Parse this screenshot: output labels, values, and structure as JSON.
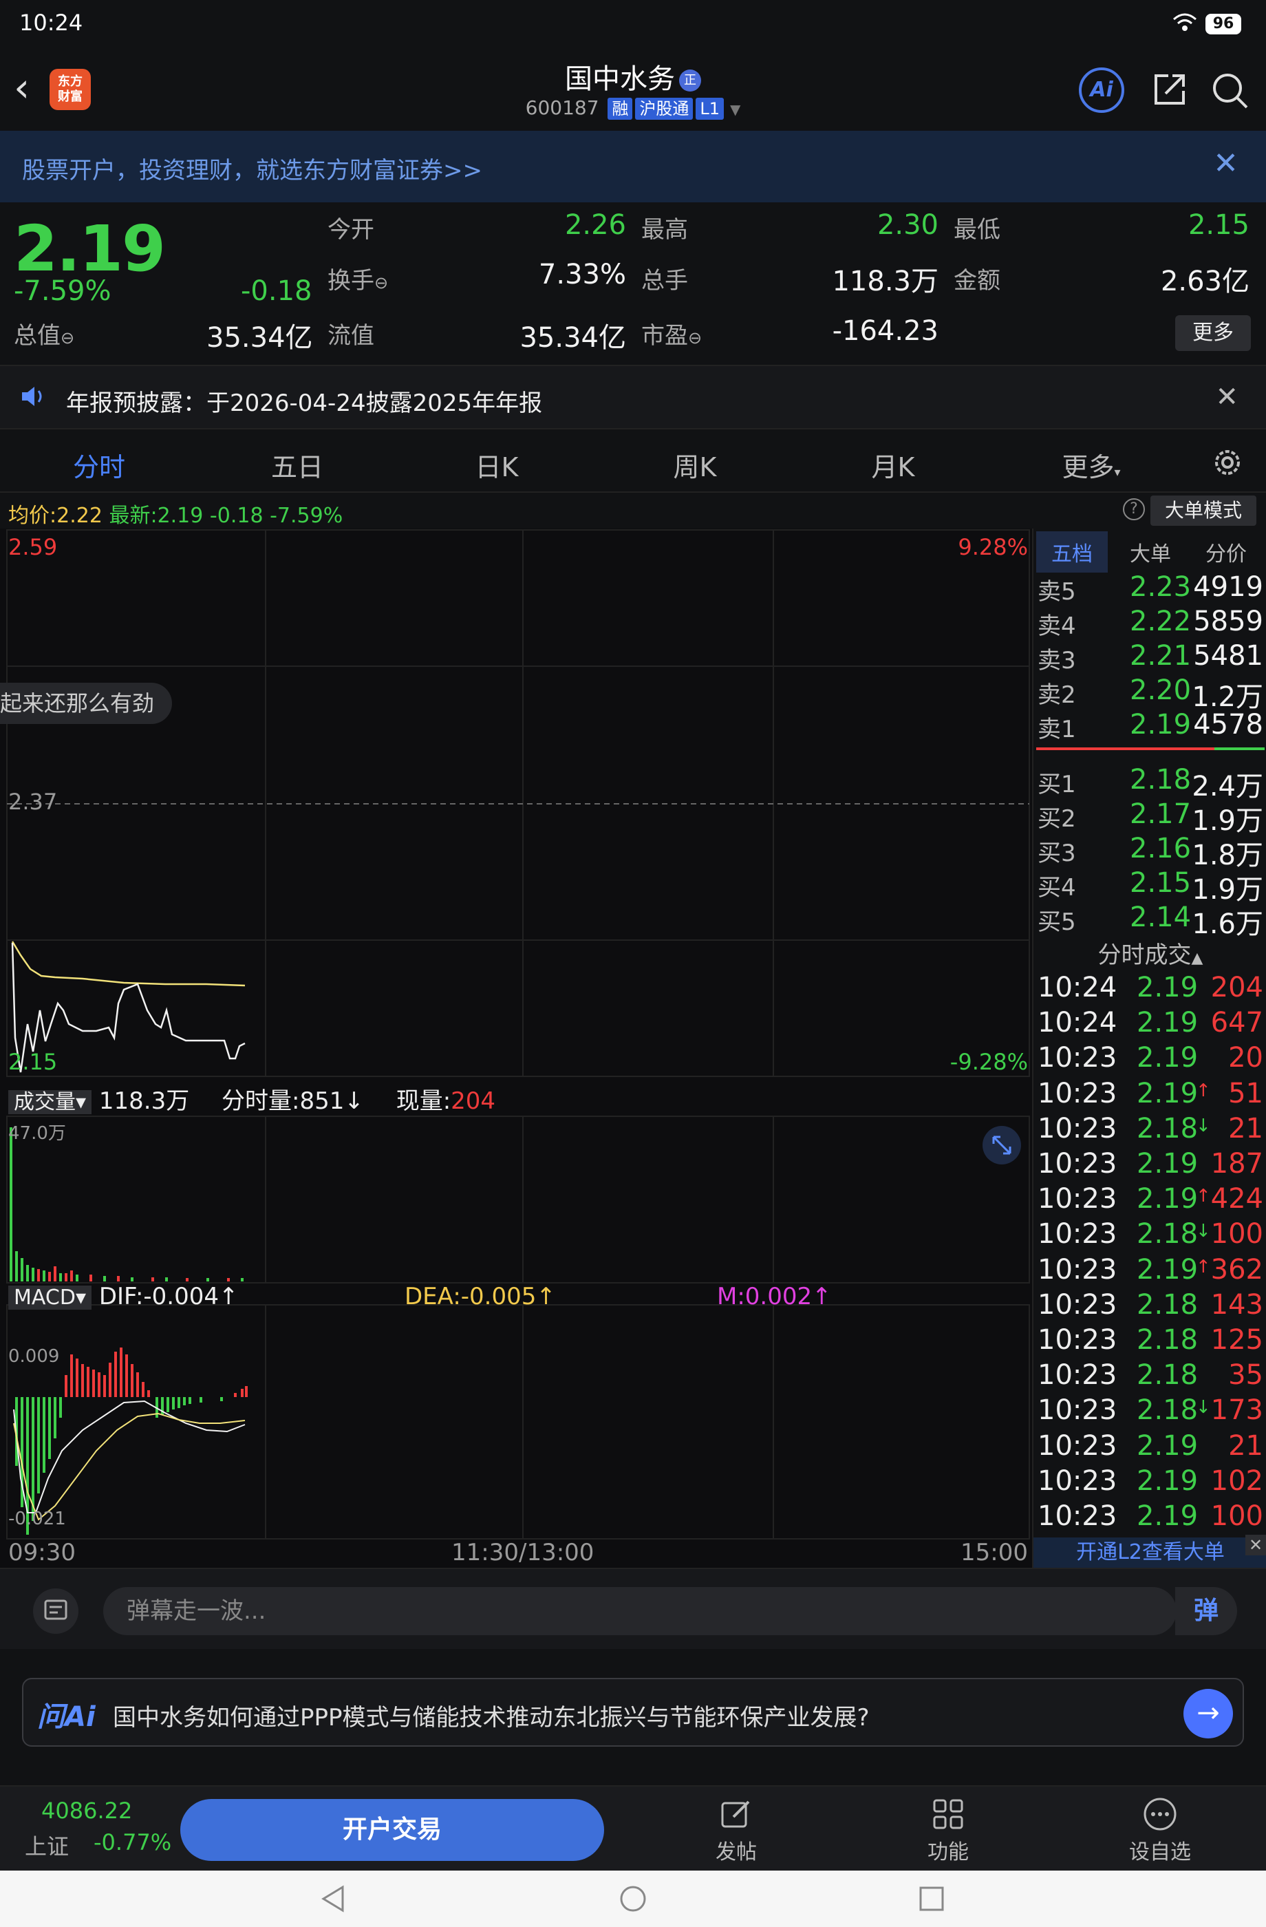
{
  "status": {
    "time": "10:24",
    "battery": "96"
  },
  "header": {
    "logo": "东方\n财富",
    "title": "国中水务",
    "title_badge": "正",
    "code": "600187",
    "tags": [
      "融",
      "沪股通",
      "L1"
    ],
    "ai_label": "Ai"
  },
  "banner": {
    "text": "股票开户，投资理财，就选东方财富证券>>"
  },
  "quote": {
    "price": "2.19",
    "pct": "-7.59%",
    "change": "-0.18",
    "mv_label": "总值",
    "mv_value": "35.34亿",
    "fields": [
      {
        "label": "今开",
        "value": "2.26",
        "color": "green"
      },
      {
        "label": "最高",
        "value": "2.30",
        "color": "green"
      },
      {
        "label": "最低",
        "value": "2.15",
        "color": "green"
      },
      {
        "label": "换手",
        "value": "7.33%",
        "color": "white"
      },
      {
        "label": "总手",
        "value": "118.3万",
        "color": "white"
      },
      {
        "label": "金额",
        "value": "2.63亿",
        "color": "white"
      },
      {
        "label": "流值",
        "value": "35.34亿",
        "color": "white"
      },
      {
        "label": "市盈",
        "value": "-164.23",
        "color": "white"
      }
    ],
    "more": "更多"
  },
  "notice": {
    "text": "年报预披露：于2026-04-24披露2025年年报"
  },
  "tabs": [
    "分时",
    "五日",
    "日K",
    "周K",
    "月K",
    "更多"
  ],
  "avg_row": {
    "avg_label": "均价:",
    "avg": "2.22",
    "latest_label": "最新:",
    "latest": "2.19",
    "change": "-0.18",
    "pct": "-7.59%",
    "mode_btn": "大单模式"
  },
  "chart": {
    "price_top": "2.59",
    "price_mid": "2.37",
    "price_bottom": "2.15",
    "pct_top": "9.28%",
    "pct_bottom": "-9.28%",
    "danmaku": "起来还那么有劲",
    "volume_label": "成交量",
    "volume_total": "118.3万",
    "volume_minute": "分时量:851",
    "volume_now_label": "现量:",
    "volume_now": "204",
    "volume_axis": "47.0万",
    "macd_label": "MACD",
    "dif": "DIF:-0.004",
    "dea": "DEA:-0.005",
    "m": "M:0.002",
    "macd_top": "0.009",
    "macd_bottom": "-0.021",
    "time_axis": [
      "09:30",
      "11:30/13:00",
      "15:00"
    ]
  },
  "panel": {
    "tabs": [
      "五档",
      "大单",
      "分价"
    ],
    "asks": [
      {
        "label": "卖5",
        "price": "2.23",
        "vol": "4919"
      },
      {
        "label": "卖4",
        "price": "2.22",
        "vol": "5859"
      },
      {
        "label": "卖3",
        "price": "2.21",
        "vol": "5481"
      },
      {
        "label": "卖2",
        "price": "2.20",
        "vol": "1.2万"
      },
      {
        "label": "卖1",
        "price": "2.19",
        "vol": "4578"
      }
    ],
    "bids": [
      {
        "label": "买1",
        "price": "2.18",
        "vol": "2.4万"
      },
      {
        "label": "买2",
        "price": "2.17",
        "vol": "1.9万"
      },
      {
        "label": "买3",
        "price": "2.16",
        "vol": "1.8万"
      },
      {
        "label": "买4",
        "price": "2.15",
        "vol": "1.9万"
      },
      {
        "label": "买5",
        "price": "2.14",
        "vol": "1.6万"
      }
    ],
    "trades_title": "分时成交",
    "trades": [
      {
        "time": "10:24",
        "price": "2.19",
        "arrow": "",
        "vol": "204"
      },
      {
        "time": "10:24",
        "price": "2.19",
        "arrow": "",
        "vol": "647"
      },
      {
        "time": "10:23",
        "price": "2.19",
        "arrow": "",
        "vol": "20"
      },
      {
        "time": "10:23",
        "price": "2.19",
        "arrow": "↑",
        "vol": "51"
      },
      {
        "time": "10:23",
        "price": "2.18",
        "arrow": "↓",
        "vol": "21"
      },
      {
        "time": "10:23",
        "price": "2.19",
        "arrow": "",
        "vol": "187"
      },
      {
        "time": "10:23",
        "price": "2.19",
        "arrow": "↑",
        "vol": "424"
      },
      {
        "time": "10:23",
        "price": "2.18",
        "arrow": "↓",
        "vol": "100"
      },
      {
        "time": "10:23",
        "price": "2.19",
        "arrow": "↑",
        "vol": "362"
      },
      {
        "time": "10:23",
        "price": "2.18",
        "arrow": "",
        "vol": "143"
      },
      {
        "time": "10:23",
        "price": "2.18",
        "arrow": "",
        "vol": "125"
      },
      {
        "time": "10:23",
        "price": "2.18",
        "arrow": "",
        "vol": "35"
      },
      {
        "time": "10:23",
        "price": "2.18",
        "arrow": "↓",
        "vol": "173"
      },
      {
        "time": "10:23",
        "price": "2.19",
        "arrow": "",
        "vol": "21"
      },
      {
        "time": "10:23",
        "price": "2.19",
        "arrow": "",
        "vol": "102"
      },
      {
        "time": "10:23",
        "price": "2.19",
        "arrow": "",
        "vol": "100"
      }
    ],
    "l2_link": "开通L2查看大单"
  },
  "danmu": {
    "placeholder": "弹幕走一波...",
    "btn": "弹"
  },
  "askai": {
    "logo": "问Ai",
    "question": "国中水务如何通过PPP模式与储能技术推动东北振兴与节能环保产业发展?"
  },
  "toolbar": {
    "index_value": "4086.22",
    "index_name": "上证",
    "index_pct": "-0.77%",
    "open_btn": "开户交易",
    "items": [
      "发帖",
      "功能",
      "设自选"
    ]
  }
}
